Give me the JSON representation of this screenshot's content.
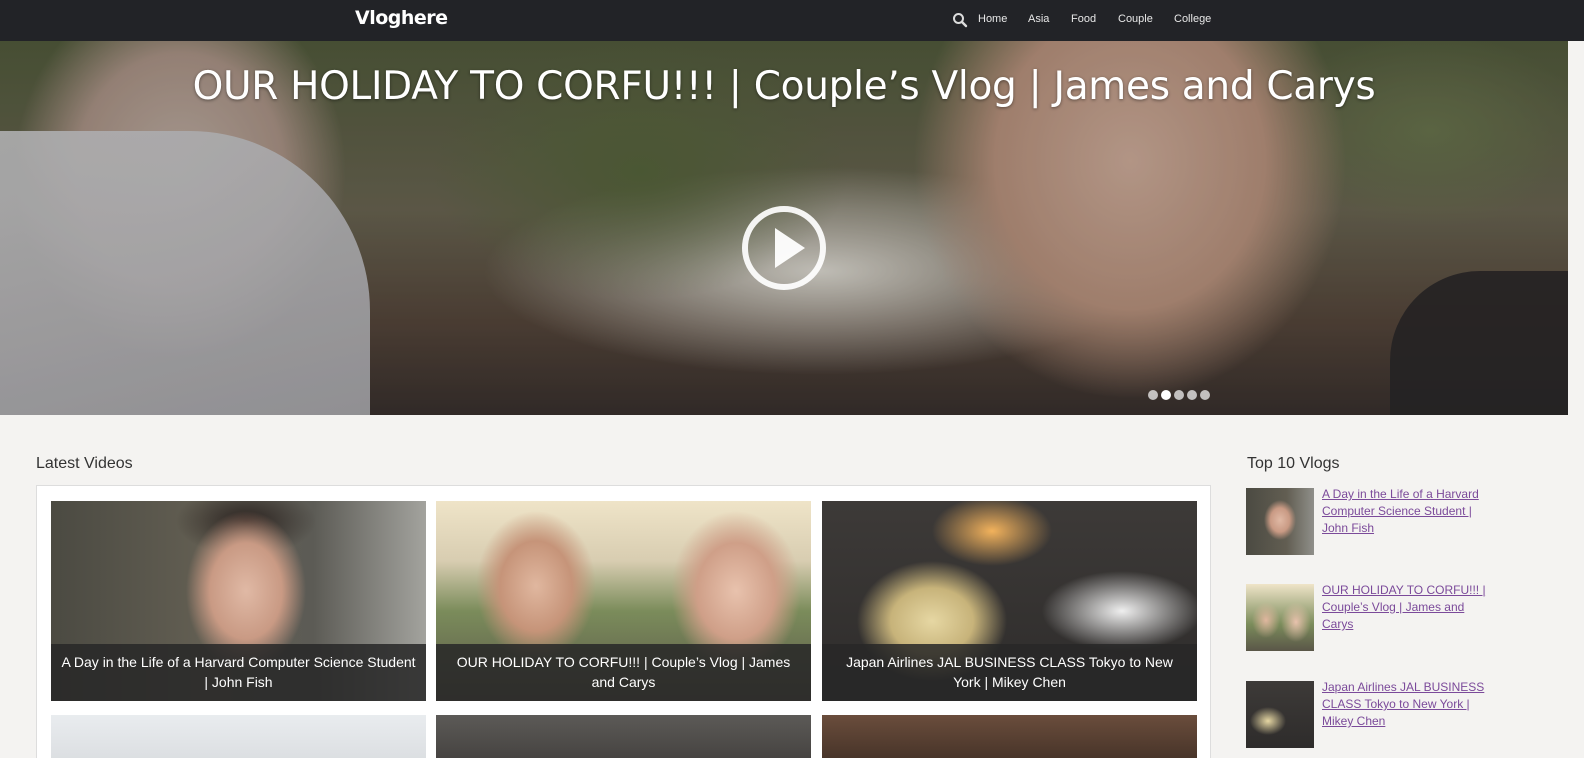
{
  "navbar": {
    "brand": "Vloghere",
    "search_icon": "search-icon",
    "links": [
      "Home",
      "Asia",
      "Food",
      "Couple",
      "College"
    ]
  },
  "hero": {
    "title": "OUR HOLIDAY TO CORFU!!! | Couple’s Vlog | James and Carys",
    "play_icon": "play-icon",
    "slide_count": 5,
    "active_slide": 2
  },
  "latest": {
    "heading": "Latest Videos",
    "videos": [
      {
        "title": "A Day in the Life of a Harvard Computer Science Student | John Fish"
      },
      {
        "title": "OUR HOLIDAY TO CORFU!!! | Couple’s Vlog | James and Carys"
      },
      {
        "title": "Japan Airlines JAL BUSINESS CLASS Tokyo to New York | Mikey Chen"
      }
    ]
  },
  "top10": {
    "heading": "Top 10 Vlogs",
    "items": [
      {
        "title": "A Day in the Life of a Harvard Computer Science Student | John Fish"
      },
      {
        "title": "OUR HOLIDAY TO CORFU!!! | Couple’s Vlog | James and Carys"
      },
      {
        "title": "Japan Airlines JAL BUSINESS CLASS Tokyo to New York | Mikey Chen"
      }
    ]
  },
  "colors": {
    "navbar_bg": "#222327",
    "page_bg": "#f4f3f1",
    "link_visited": "#7b4a9a",
    "caption_bg": "#282828"
  }
}
